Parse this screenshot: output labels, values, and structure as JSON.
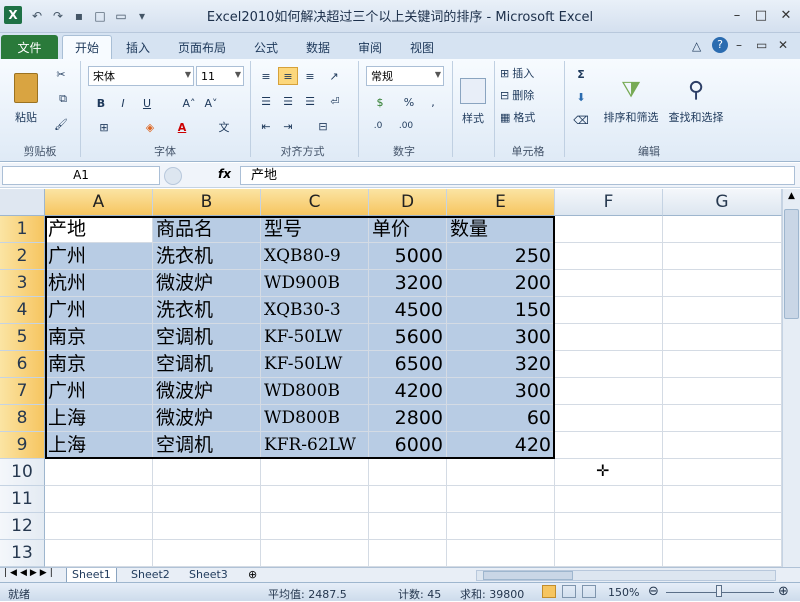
{
  "window": {
    "title": "Excel2010如何解决超过三个以上关键词的排序  -  Microsoft Excel"
  },
  "tabs": [
    "文件",
    "开始",
    "插入",
    "页面布局",
    "公式",
    "数据",
    "审阅",
    "视图"
  ],
  "ribbon": {
    "clipboard": {
      "paste": "粘贴",
      "group": "剪贴板"
    },
    "font": {
      "name": "宋体",
      "size": "11",
      "group": "字体"
    },
    "alignment": {
      "group": "对齐方式"
    },
    "number": {
      "format": "常规",
      "group": "数字"
    },
    "styles": {
      "label": "样式"
    },
    "cells": {
      "insert": "插入",
      "delete": "删除",
      "format": "格式",
      "group": "单元格"
    },
    "editing": {
      "sort": "排序和筛选",
      "find": "查找和选择",
      "group": "编辑"
    }
  },
  "formula_bar": {
    "name_box": "A1",
    "fx": "fx",
    "content": "产地"
  },
  "columns": [
    "A",
    "B",
    "C",
    "D",
    "E",
    "F",
    "G"
  ],
  "rows": [
    "1",
    "2",
    "3",
    "4",
    "5",
    "6",
    "7",
    "8",
    "9",
    "10",
    "11",
    "12",
    "13"
  ],
  "table": {
    "headers": [
      "产地",
      "商品名",
      "型号",
      "单价",
      "数量"
    ],
    "data": [
      [
        "广州",
        "洗衣机",
        "XQB80-9",
        "5000",
        "250"
      ],
      [
        "杭州",
        "微波炉",
        "WD900B",
        "3200",
        "200"
      ],
      [
        "广州",
        "洗衣机",
        "XQB30-3",
        "4500",
        "150"
      ],
      [
        "南京",
        "空调机",
        "KF-50LW",
        "5600",
        "300"
      ],
      [
        "南京",
        "空调机",
        "KF-50LW",
        "6500",
        "320"
      ],
      [
        "广州",
        "微波炉",
        "WD800B",
        "4200",
        "300"
      ],
      [
        "上海",
        "微波炉",
        "WD800B",
        "2800",
        "60"
      ],
      [
        "上海",
        "空调机",
        "KFR-62LW",
        "6000",
        "420"
      ]
    ]
  },
  "sheets": [
    "Sheet1",
    "Sheet2",
    "Sheet3"
  ],
  "status": {
    "ready": "就绪",
    "average": "平均值: 2487.5",
    "count": "计数: 45",
    "sum": "求和: 39800",
    "zoom": "150%"
  }
}
